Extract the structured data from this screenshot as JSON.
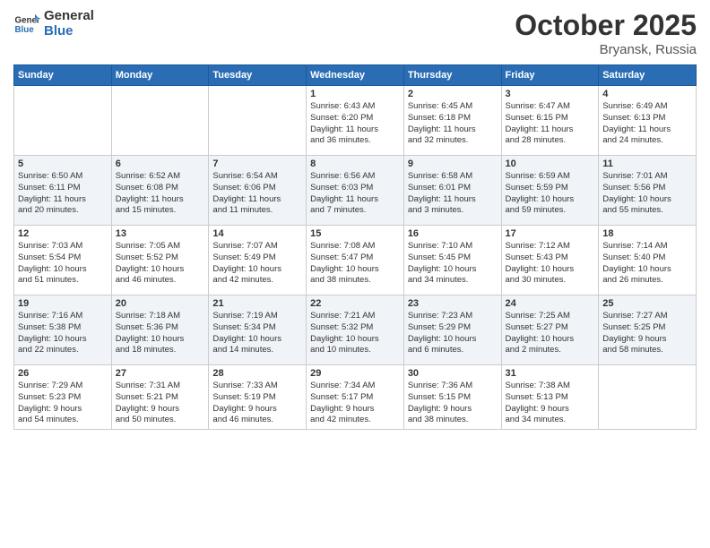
{
  "header": {
    "logo_general": "General",
    "logo_blue": "Blue",
    "month": "October 2025",
    "location": "Bryansk, Russia"
  },
  "days_of_week": [
    "Sunday",
    "Monday",
    "Tuesday",
    "Wednesday",
    "Thursday",
    "Friday",
    "Saturday"
  ],
  "weeks": [
    [
      {
        "day": "",
        "info": ""
      },
      {
        "day": "",
        "info": ""
      },
      {
        "day": "",
        "info": ""
      },
      {
        "day": "1",
        "info": "Sunrise: 6:43 AM\nSunset: 6:20 PM\nDaylight: 11 hours\nand 36 minutes."
      },
      {
        "day": "2",
        "info": "Sunrise: 6:45 AM\nSunset: 6:18 PM\nDaylight: 11 hours\nand 32 minutes."
      },
      {
        "day": "3",
        "info": "Sunrise: 6:47 AM\nSunset: 6:15 PM\nDaylight: 11 hours\nand 28 minutes."
      },
      {
        "day": "4",
        "info": "Sunrise: 6:49 AM\nSunset: 6:13 PM\nDaylight: 11 hours\nand 24 minutes."
      }
    ],
    [
      {
        "day": "5",
        "info": "Sunrise: 6:50 AM\nSunset: 6:11 PM\nDaylight: 11 hours\nand 20 minutes."
      },
      {
        "day": "6",
        "info": "Sunrise: 6:52 AM\nSunset: 6:08 PM\nDaylight: 11 hours\nand 15 minutes."
      },
      {
        "day": "7",
        "info": "Sunrise: 6:54 AM\nSunset: 6:06 PM\nDaylight: 11 hours\nand 11 minutes."
      },
      {
        "day": "8",
        "info": "Sunrise: 6:56 AM\nSunset: 6:03 PM\nDaylight: 11 hours\nand 7 minutes."
      },
      {
        "day": "9",
        "info": "Sunrise: 6:58 AM\nSunset: 6:01 PM\nDaylight: 11 hours\nand 3 minutes."
      },
      {
        "day": "10",
        "info": "Sunrise: 6:59 AM\nSunset: 5:59 PM\nDaylight: 10 hours\nand 59 minutes."
      },
      {
        "day": "11",
        "info": "Sunrise: 7:01 AM\nSunset: 5:56 PM\nDaylight: 10 hours\nand 55 minutes."
      }
    ],
    [
      {
        "day": "12",
        "info": "Sunrise: 7:03 AM\nSunset: 5:54 PM\nDaylight: 10 hours\nand 51 minutes."
      },
      {
        "day": "13",
        "info": "Sunrise: 7:05 AM\nSunset: 5:52 PM\nDaylight: 10 hours\nand 46 minutes."
      },
      {
        "day": "14",
        "info": "Sunrise: 7:07 AM\nSunset: 5:49 PM\nDaylight: 10 hours\nand 42 minutes."
      },
      {
        "day": "15",
        "info": "Sunrise: 7:08 AM\nSunset: 5:47 PM\nDaylight: 10 hours\nand 38 minutes."
      },
      {
        "day": "16",
        "info": "Sunrise: 7:10 AM\nSunset: 5:45 PM\nDaylight: 10 hours\nand 34 minutes."
      },
      {
        "day": "17",
        "info": "Sunrise: 7:12 AM\nSunset: 5:43 PM\nDaylight: 10 hours\nand 30 minutes."
      },
      {
        "day": "18",
        "info": "Sunrise: 7:14 AM\nSunset: 5:40 PM\nDaylight: 10 hours\nand 26 minutes."
      }
    ],
    [
      {
        "day": "19",
        "info": "Sunrise: 7:16 AM\nSunset: 5:38 PM\nDaylight: 10 hours\nand 22 minutes."
      },
      {
        "day": "20",
        "info": "Sunrise: 7:18 AM\nSunset: 5:36 PM\nDaylight: 10 hours\nand 18 minutes."
      },
      {
        "day": "21",
        "info": "Sunrise: 7:19 AM\nSunset: 5:34 PM\nDaylight: 10 hours\nand 14 minutes."
      },
      {
        "day": "22",
        "info": "Sunrise: 7:21 AM\nSunset: 5:32 PM\nDaylight: 10 hours\nand 10 minutes."
      },
      {
        "day": "23",
        "info": "Sunrise: 7:23 AM\nSunset: 5:29 PM\nDaylight: 10 hours\nand 6 minutes."
      },
      {
        "day": "24",
        "info": "Sunrise: 7:25 AM\nSunset: 5:27 PM\nDaylight: 10 hours\nand 2 minutes."
      },
      {
        "day": "25",
        "info": "Sunrise: 7:27 AM\nSunset: 5:25 PM\nDaylight: 9 hours\nand 58 minutes."
      }
    ],
    [
      {
        "day": "26",
        "info": "Sunrise: 7:29 AM\nSunset: 5:23 PM\nDaylight: 9 hours\nand 54 minutes."
      },
      {
        "day": "27",
        "info": "Sunrise: 7:31 AM\nSunset: 5:21 PM\nDaylight: 9 hours\nand 50 minutes."
      },
      {
        "day": "28",
        "info": "Sunrise: 7:33 AM\nSunset: 5:19 PM\nDaylight: 9 hours\nand 46 minutes."
      },
      {
        "day": "29",
        "info": "Sunrise: 7:34 AM\nSunset: 5:17 PM\nDaylight: 9 hours\nand 42 minutes."
      },
      {
        "day": "30",
        "info": "Sunrise: 7:36 AM\nSunset: 5:15 PM\nDaylight: 9 hours\nand 38 minutes."
      },
      {
        "day": "31",
        "info": "Sunrise: 7:38 AM\nSunset: 5:13 PM\nDaylight: 9 hours\nand 34 minutes."
      },
      {
        "day": "",
        "info": ""
      }
    ]
  ]
}
